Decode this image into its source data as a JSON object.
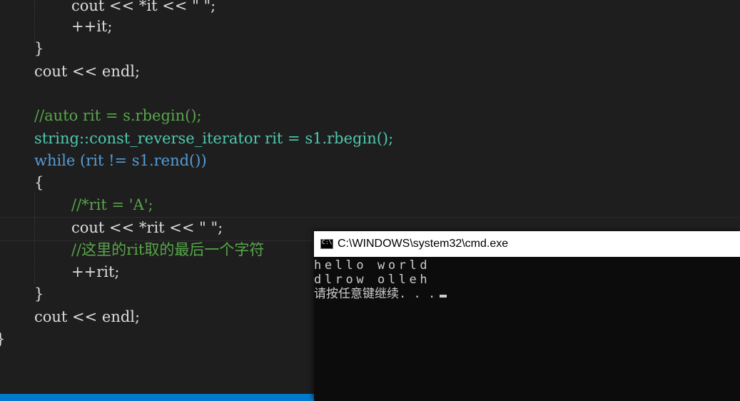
{
  "editor": {
    "lines": [
      "cout << *it << \" \";",
      "++it;",
      "}",
      "cout << endl;",
      "",
      "//auto rit = s.rbegin();",
      "string::const_reverse_iterator rit = s1.rbegin();",
      "while (rit != s1.rend())",
      "{",
      "//*rit = 'A';",
      "cout << *rit << \" \";",
      "//这里的rit取的最后一个字符",
      "++rit;",
      "}",
      "cout << endl;",
      "}"
    ]
  },
  "console": {
    "title": "C:\\WINDOWS\\system32\\cmd.exe",
    "icon": "cmd-window-icon",
    "output": [
      "hello world",
      "dlrow olleh",
      "请按任意键继续. . ."
    ]
  },
  "colors": {
    "keyword": "#569cd6",
    "type": "#4ec9b0",
    "comment": "#57a64a",
    "string": "#d69d85",
    "background": "#1e1e1e",
    "statusbar": "#007acc"
  }
}
